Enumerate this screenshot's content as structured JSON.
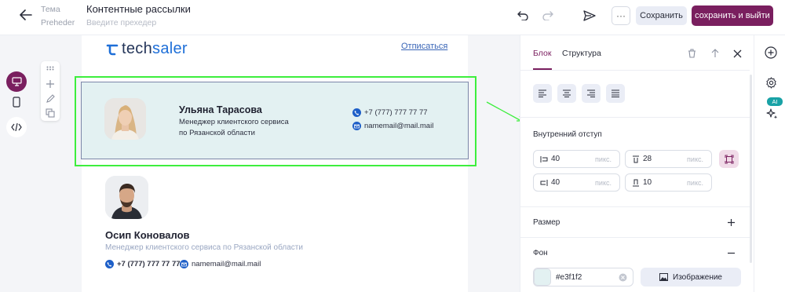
{
  "header": {
    "topic_label": "Тема",
    "topic_value": "Контентные рассылки",
    "preheader_label": "Preheder",
    "preheader_placeholder": "Введите прехедер",
    "save_label": "Сохранить",
    "save_exit_label": "сохранить и выйти",
    "more_label": "···"
  },
  "email": {
    "logo_prefix": "tech",
    "logo_suffix": "saler",
    "unsubscribe": "Отписаться",
    "card1": {
      "name": "Ульяна Тарасова",
      "role_line1": "Менеджер клиентского сервиса",
      "role_line2": "по Рязанской области",
      "phone": "+7 (777) 777 77 77",
      "email": "namemail@mail.mail",
      "background": "#e3f1f2"
    },
    "card2": {
      "name": "Осип Коновалов",
      "role": "Менеджер клиентского сервиса по Рязанской области",
      "phone": "+7 (777) 777 77 77",
      "email": "namemail@mail.mail"
    }
  },
  "panel": {
    "tab_block": "Блок",
    "tab_structure": "Структура",
    "padding_label": "Внутренний отступ",
    "unit": "пикс.",
    "padding_left": "40",
    "padding_top": "28",
    "padding_right": "40",
    "padding_bottom": "10",
    "size_label": "Размер",
    "bg_label": "Фон",
    "bg_color": "#e3f1f2",
    "image_button": "Изображение"
  },
  "rightrail": {
    "ai_badge": "AI"
  },
  "colors": {
    "accent": "#7a1f5f",
    "selection": "#3dee3d",
    "brand_blue": "#1e6fd8"
  }
}
